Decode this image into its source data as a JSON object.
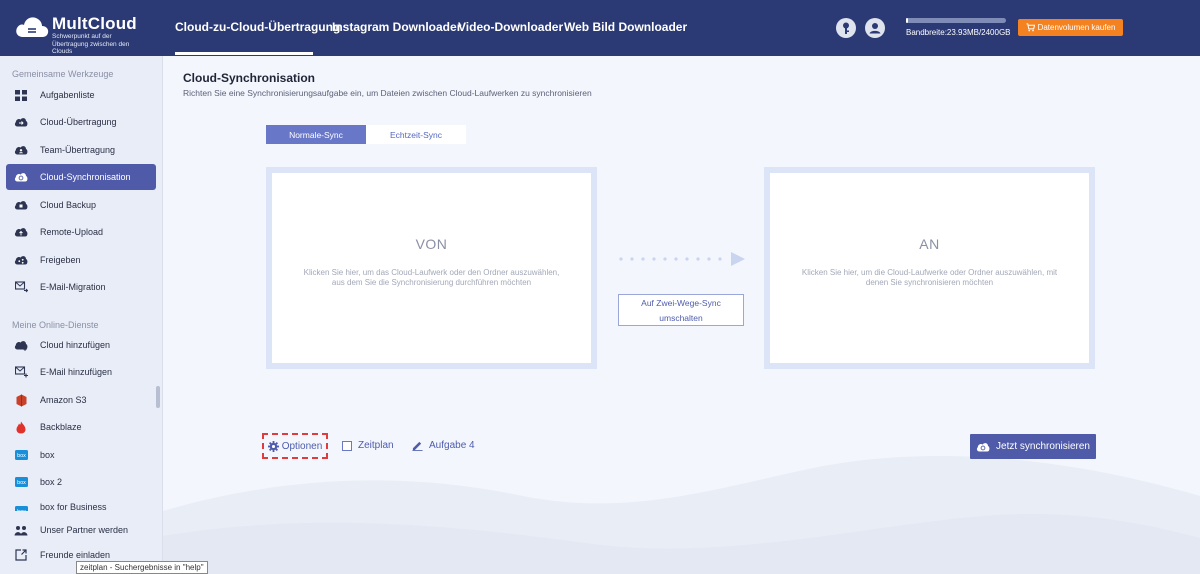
{
  "brand": {
    "name": "MultCloud",
    "tagline": "Schwerpunkt auf der Übertragung zwischen den Clouds"
  },
  "nav": {
    "items": [
      {
        "label": "Cloud-zu-Cloud-Übertragung",
        "active": true
      },
      {
        "label": "Instagram Downloader",
        "active": false
      },
      {
        "label": "Video-Downloader",
        "active": false
      },
      {
        "label": "Web Bild Downloader",
        "active": false
      }
    ]
  },
  "header": {
    "icons": [
      "key-icon",
      "user-icon"
    ],
    "bandwidth_label": "Bandbreite:23.93MB/2400GB",
    "bandwidth_used_fraction": 0.01,
    "buy_button": "Datenvolumen kaufen"
  },
  "sidebar": {
    "section_tools": "Gemeinsame Werkzeuge",
    "tools": [
      {
        "label": "Aufgabenliste",
        "icon": "grid-icon"
      },
      {
        "label": "Cloud-Übertragung",
        "icon": "cloud-transfer-icon"
      },
      {
        "label": "Team-Übertragung",
        "icon": "team-transfer-icon"
      },
      {
        "label": "Cloud-Synchronisation",
        "icon": "cloud-sync-icon",
        "active": true
      },
      {
        "label": "Cloud Backup",
        "icon": "cloud-backup-icon"
      },
      {
        "label": "Remote-Upload",
        "icon": "remote-upload-icon"
      },
      {
        "label": "Freigeben",
        "icon": "share-icon"
      },
      {
        "label": "E-Mail-Migration",
        "icon": "email-migration-icon"
      }
    ],
    "section_services": "Meine Online-Dienste",
    "services": [
      {
        "label": "Cloud hinzufügen",
        "icon": "cloud-add-icon"
      },
      {
        "label": "E-Mail hinzufügen",
        "icon": "email-add-icon"
      },
      {
        "label": "Amazon S3",
        "icon": "amazon-s3-icon"
      },
      {
        "label": "Backblaze",
        "icon": "backblaze-icon"
      },
      {
        "label": "box",
        "icon": "box-icon"
      },
      {
        "label": "box 2",
        "icon": "box-icon"
      },
      {
        "label": "box for Business",
        "icon": "box-icon"
      }
    ],
    "footer": [
      {
        "label": "Unser Partner werden",
        "icon": "partner-icon"
      },
      {
        "label": "Freunde einladen",
        "icon": "invite-icon"
      }
    ],
    "tooltip": "zeitplan - Suchergebnisse in \"help\""
  },
  "main": {
    "title": "Cloud-Synchronisation",
    "subtitle": "Richten Sie eine Synchronisierungsaufgabe ein, um Dateien zwischen Cloud-Laufwerken zu synchronisieren",
    "tabs": [
      {
        "label": "Normale-Sync",
        "active": true
      },
      {
        "label": "Echtzeit-Sync",
        "active": false
      }
    ],
    "from": {
      "title": "VON",
      "description": "Klicken Sie hier, um das Cloud-Laufwerk oder den Ordner auszuwählen, aus dem Sie die Synchronisierung durchführen möchten"
    },
    "to": {
      "title": "AN",
      "description": "Klicken Sie hier, um die Cloud-Laufwerke oder Ordner auszuwählen, mit denen Sie synchronisieren möchten"
    },
    "two_way_button": {
      "line1": "Auf Zwei-Wege-Sync",
      "line2": "umschalten"
    },
    "options_label": "Optionen",
    "schedule_label": "Zeitplan",
    "task_label": "Aufgabe 4",
    "sync_button": "Jetzt synchronisieren"
  },
  "colors": {
    "header_bg": "#2b3a74",
    "accent": "#4f5ba8",
    "buy_orange": "#f58220",
    "highlight_red": "#e23b3b"
  }
}
